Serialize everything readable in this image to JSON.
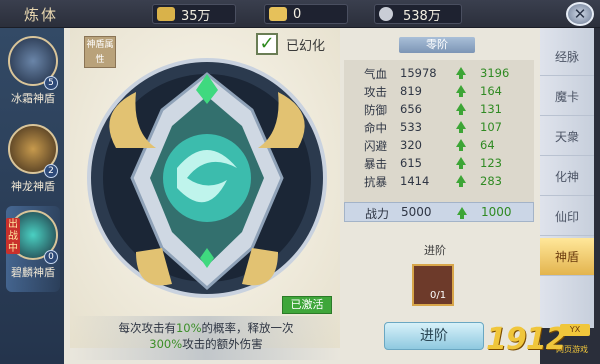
{
  "header": {
    "title": "炼体",
    "resources": [
      {
        "icon": "coin-icon",
        "value": "35万"
      },
      {
        "icon": "ingot-icon",
        "value": "0"
      },
      {
        "icon": "silver-icon",
        "value": "538万"
      }
    ]
  },
  "shields": [
    {
      "name": "冰霜神盾",
      "count": "5"
    },
    {
      "name": "神龙神盾",
      "count": "2"
    },
    {
      "name": "碧麟神盾",
      "count": "0"
    }
  ],
  "fight_tag": "出战中",
  "attr_tag": "神盾属性",
  "transform_label": "已幻化",
  "activated_label": "已激活",
  "description": {
    "p1": "每次攻击有",
    "pct1": "10%",
    "p2": "的概率，释放一次",
    "pct2": "300%",
    "p3": "攻击的额外伤害"
  },
  "tier_label": "零阶",
  "stats": [
    {
      "name": "气血",
      "value": "15978",
      "gain": "3196"
    },
    {
      "name": "攻击",
      "value": "819",
      "gain": "164"
    },
    {
      "name": "防御",
      "value": "656",
      "gain": "131"
    },
    {
      "name": "命中",
      "value": "533",
      "gain": "107"
    },
    {
      "name": "闪避",
      "value": "320",
      "gain": "64"
    },
    {
      "name": "暴击",
      "value": "615",
      "gain": "123"
    },
    {
      "name": "抗暴",
      "value": "1414",
      "gain": "283"
    }
  ],
  "power": {
    "name": "战力",
    "value": "5000",
    "gain": "1000"
  },
  "advance_section_label": "进阶",
  "advance_item_count": "0/1",
  "advance_button": "进阶",
  "tabs": [
    "经脉",
    "魔卡",
    "天衆",
    "化神",
    "仙印",
    "神盾"
  ],
  "watermark": {
    "logo": "1912",
    "badge": "YX",
    "sub": "网页游戏"
  }
}
